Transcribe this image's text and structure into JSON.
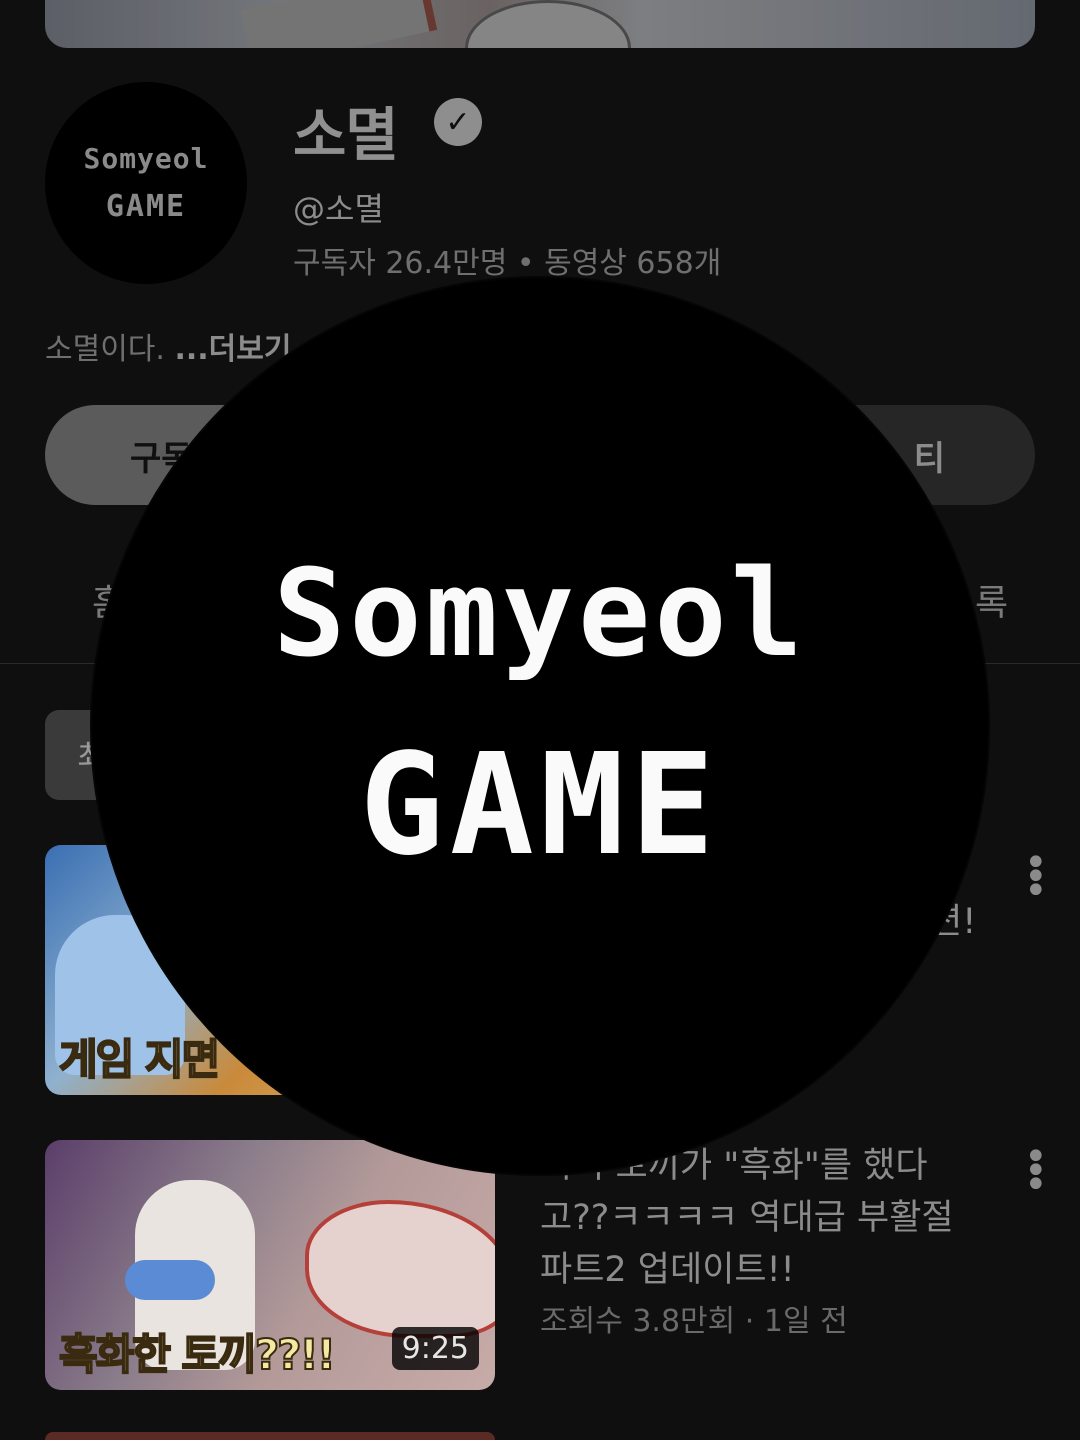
{
  "channel": {
    "name": "소멸",
    "verified_icon": "check-circle-icon",
    "handle": "@소멸",
    "stats": "구독자 26.4만명 • 동영상 658개",
    "description": "소멸이다.",
    "more_label": "...더보기",
    "avatar_line1": "Somyeol",
    "avatar_line2": "GAME"
  },
  "buttons": {
    "subscribe_partial": "구독",
    "community_partial": "티"
  },
  "tabs": {
    "left_partial": "홈",
    "right_partial": "록"
  },
  "chips": {
    "first_partial": "최"
  },
  "videos": [
    {
      "title_visible_suffix": "션!",
      "thumb_caption": "게임 지면",
      "more_icon": "more-vert-icon"
    },
    {
      "title": "이디 토끼가 \"흑화\"를 했다고??ㅋㅋㅋㅋ 역대급 부활절 파트2 업데이트!!",
      "meta": "조회수 3.8만회 · 1일 전",
      "thumb_caption": "흑화한 토끼??!!",
      "duration": "9:25",
      "more_icon": "more-vert-icon"
    }
  ],
  "overlay": {
    "line1": "Somyeol",
    "line2": "GAME"
  }
}
